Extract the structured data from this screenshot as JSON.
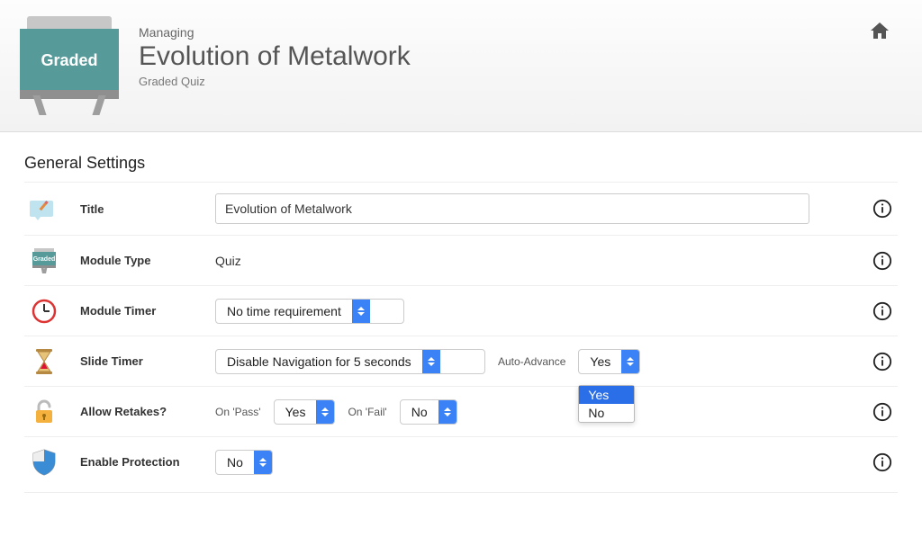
{
  "header": {
    "badge": "Graded",
    "kicker": "Managing",
    "title": "Evolution of Metalwork",
    "subtitle": "Graded Quiz"
  },
  "section_heading": "General Settings",
  "fields": {
    "title": {
      "label": "Title",
      "value": "Evolution of Metalwork"
    },
    "module_type": {
      "label": "Module Type",
      "value": "Quiz"
    },
    "module_timer": {
      "label": "Module Timer",
      "value": "No time requirement"
    },
    "slide_timer": {
      "label": "Slide Timer",
      "value": "Disable Navigation for 5 seconds",
      "auto_advance_label": "Auto-Advance",
      "auto_advance_value": "Yes",
      "auto_advance_options": [
        "Yes",
        "No"
      ]
    },
    "allow_retakes": {
      "label": "Allow Retakes?",
      "on_pass_label": "On 'Pass'",
      "on_pass_value": "Yes",
      "on_fail_label": "On 'Fail'",
      "on_fail_value": "No"
    },
    "enable_protection": {
      "label": "Enable Protection",
      "value": "No"
    }
  }
}
